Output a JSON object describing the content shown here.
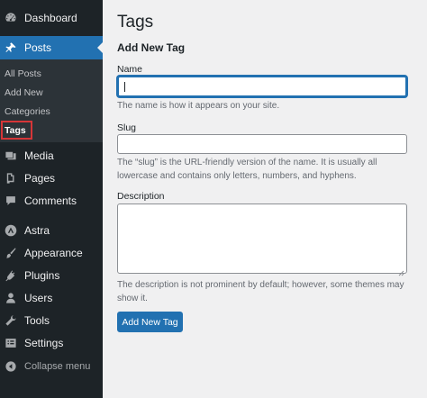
{
  "sidebar": {
    "dashboard": "Dashboard",
    "posts": "Posts",
    "submenu": {
      "all_posts": "All Posts",
      "add_new": "Add New",
      "categories": "Categories",
      "tags": "Tags"
    },
    "media": "Media",
    "pages": "Pages",
    "comments": "Comments",
    "astra": "Astra",
    "appearance": "Appearance",
    "plugins": "Plugins",
    "users": "Users",
    "tools": "Tools",
    "settings": "Settings",
    "collapse": "Collapse menu"
  },
  "main": {
    "title": "Tags",
    "section_title": "Add New Tag",
    "name": {
      "label": "Name",
      "value": "",
      "description": "The name is how it appears on your site."
    },
    "slug": {
      "label": "Slug",
      "value": "",
      "description": "The “slug” is the URL-friendly version of the name. It is usually all lowercase and contains only letters, numbers, and hyphens."
    },
    "description": {
      "label": "Description",
      "value": "",
      "description": "The description is not prominent by default; however, some themes may show it."
    },
    "submit_label": "Add New Tag"
  },
  "colors": {
    "sidebar_bg": "#1d2327",
    "submenu_bg": "#2c3338",
    "accent": "#2271b1",
    "highlight_box": "#d63638",
    "content_bg": "#f0f0f1"
  }
}
